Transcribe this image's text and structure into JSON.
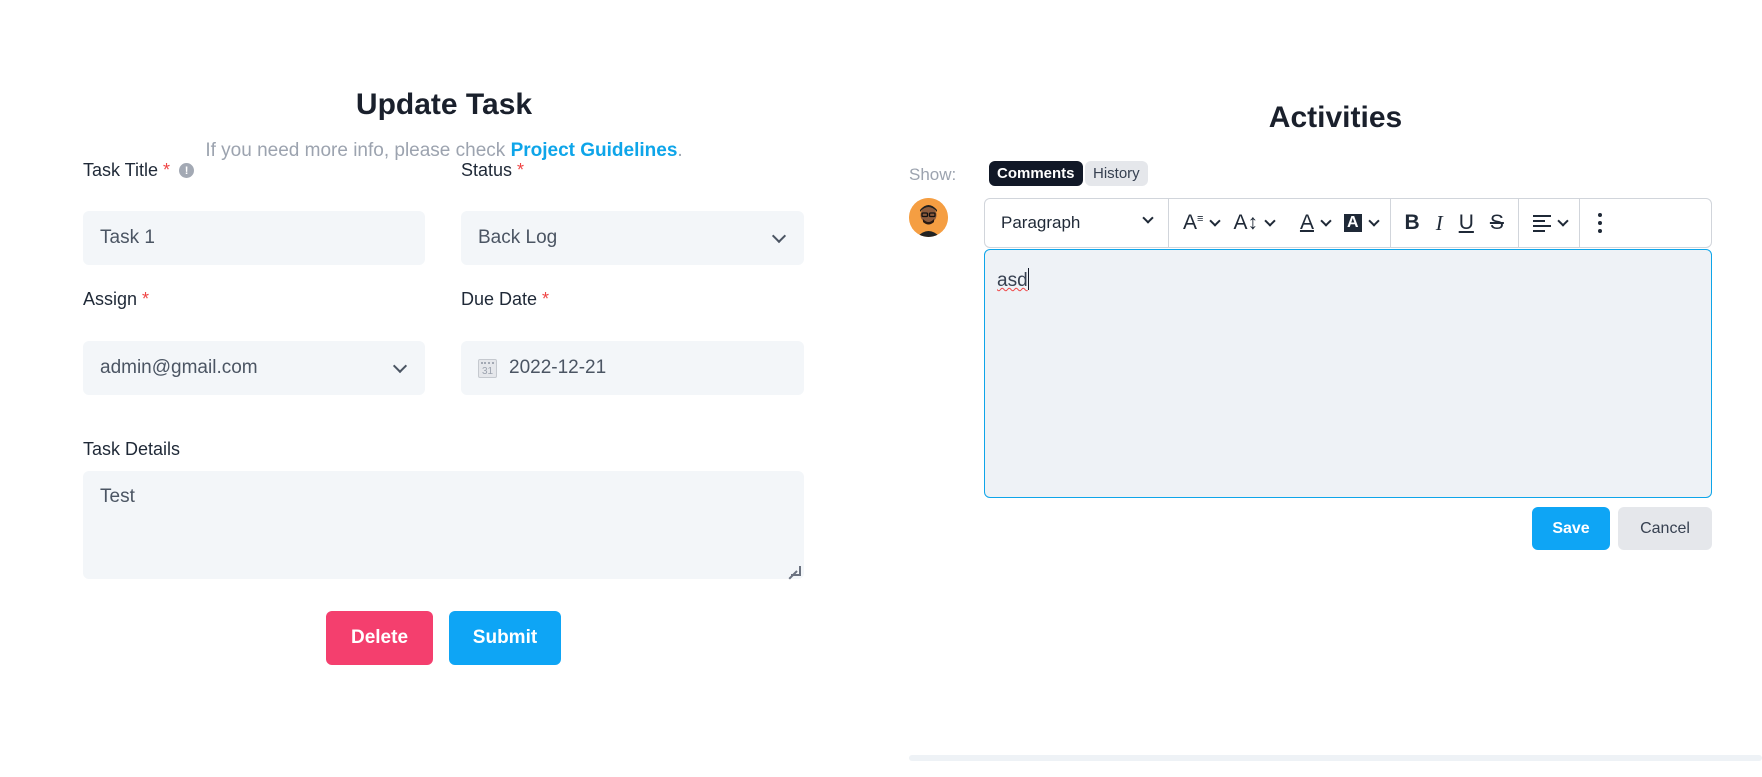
{
  "update_task": {
    "title": "Update Task",
    "subtitle_prefix": "If you need more info, please check ",
    "subtitle_link": "Project Guidelines",
    "subtitle_suffix": ".",
    "task_title_label": "Task Title",
    "status_label": "Status",
    "assign_label": "Assign",
    "due_date_label": "Due Date",
    "task_details_label": "Task Details",
    "required_mark": "*",
    "task_title_value": "Task 1",
    "status_value": "Back Log",
    "assign_value": "admin@gmail.com",
    "due_date_value": "2022-12-21",
    "calendar_day": "31",
    "task_details_value": "Test",
    "delete_label": "Delete",
    "submit_label": "Submit",
    "info_glyph": "!"
  },
  "activities": {
    "title": "Activities",
    "show_label": "Show:",
    "tab_comments": "Comments",
    "tab_history": "History",
    "editor": {
      "block_format": "Paragraph",
      "content": "asd",
      "toolbar_icons": [
        "font-size-icon",
        "line-height-icon",
        "font-color-icon",
        "highlight-icon",
        "bold-icon",
        "italic-icon",
        "underline-icon",
        "strikethrough-icon",
        "align-icon",
        "more-icon"
      ],
      "glyph_font_size": "A",
      "glyph_line_height": "A",
      "glyph_font_color": "A",
      "glyph_highlight": "A",
      "glyph_bold": "B",
      "glyph_italic": "I",
      "glyph_underline": "U",
      "glyph_strike": "S"
    },
    "save_label": "Save",
    "cancel_label": "Cancel"
  },
  "colors": {
    "primary": "#0ea5f5",
    "danger": "#f43f6e",
    "required": "#ef4444",
    "link": "#0ea5e9",
    "field_bg": "#f3f6f9"
  }
}
